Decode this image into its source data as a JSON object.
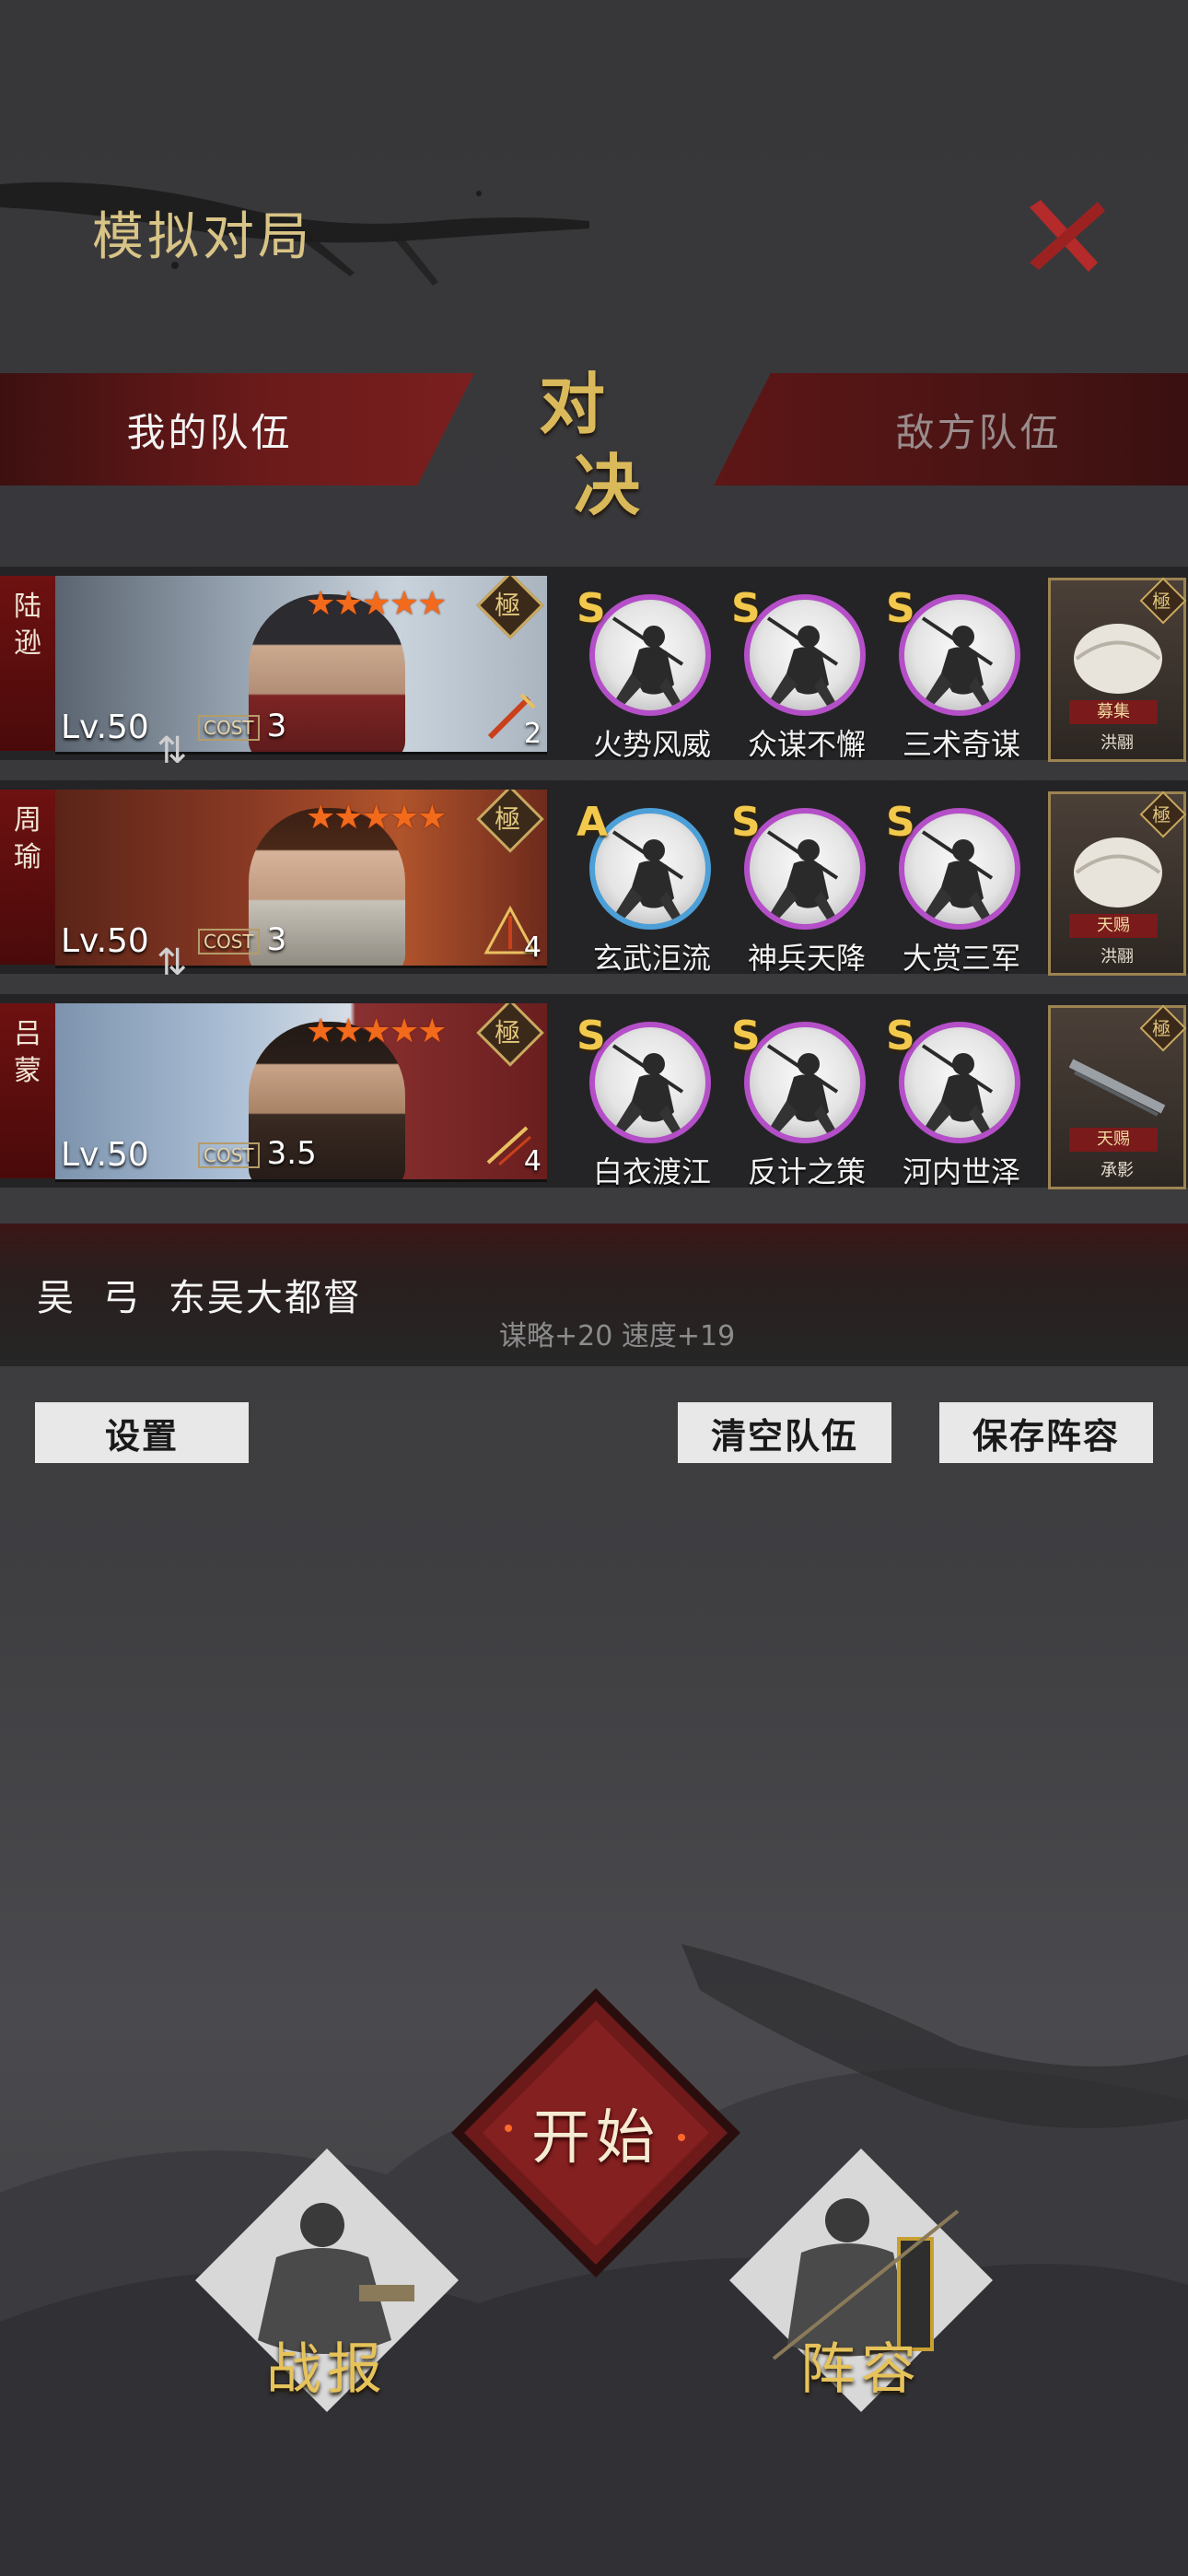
{
  "header": {
    "title": "模拟对局"
  },
  "tabs": {
    "mine": "我的队伍",
    "vs_1": "对",
    "vs_2": "决",
    "enemy": "敌方队伍"
  },
  "team": [
    {
      "name_1": "陆",
      "name_2": "逊",
      "level": "Lv.50",
      "cost_label": "COST",
      "cost": "3",
      "weapon_num": "2",
      "grade": "極",
      "skills": [
        {
          "grade": "S",
          "name": "火势风威"
        },
        {
          "grade": "S",
          "name": "众谋不懈"
        },
        {
          "grade": "S",
          "name": "三术奇谋"
        }
      ],
      "gear": {
        "tag": "募集",
        "name": "洪翮"
      }
    },
    {
      "name_1": "周",
      "name_2": "瑜",
      "level": "Lv.50",
      "cost_label": "COST",
      "cost": "3",
      "weapon_num": "4",
      "grade": "極",
      "skills": [
        {
          "grade": "A",
          "name": "玄武洰流"
        },
        {
          "grade": "S",
          "name": "神兵天降"
        },
        {
          "grade": "S",
          "name": "大赏三军"
        }
      ],
      "gear": {
        "tag": "天赐",
        "name": "洪翮"
      }
    },
    {
      "name_1": "吕",
      "name_2": "蒙",
      "level": "Lv.50",
      "cost_label": "COST",
      "cost": "3.5",
      "weapon_num": "4",
      "grade": "極",
      "skills": [
        {
          "grade": "S",
          "name": "白衣渡江"
        },
        {
          "grade": "S",
          "name": "反计之策"
        },
        {
          "grade": "S",
          "name": "河内世泽"
        }
      ],
      "gear": {
        "tag": "天赐",
        "name": "承影"
      }
    }
  ],
  "info": {
    "main": "吴  弓  东吴大都督",
    "sub": "谋略+20 速度+19"
  },
  "buttons": {
    "settings": "设置",
    "clear": "清空队伍",
    "save": "保存阵容"
  },
  "bottom": {
    "start": "开始",
    "report": "战报",
    "lineup": "阵容"
  },
  "colors": {
    "accent_red": "#6b1a1a",
    "gold": "#d9b95a",
    "skill_ring": "#b44fc8",
    "skill_ring_blue": "#4d9fd8"
  }
}
